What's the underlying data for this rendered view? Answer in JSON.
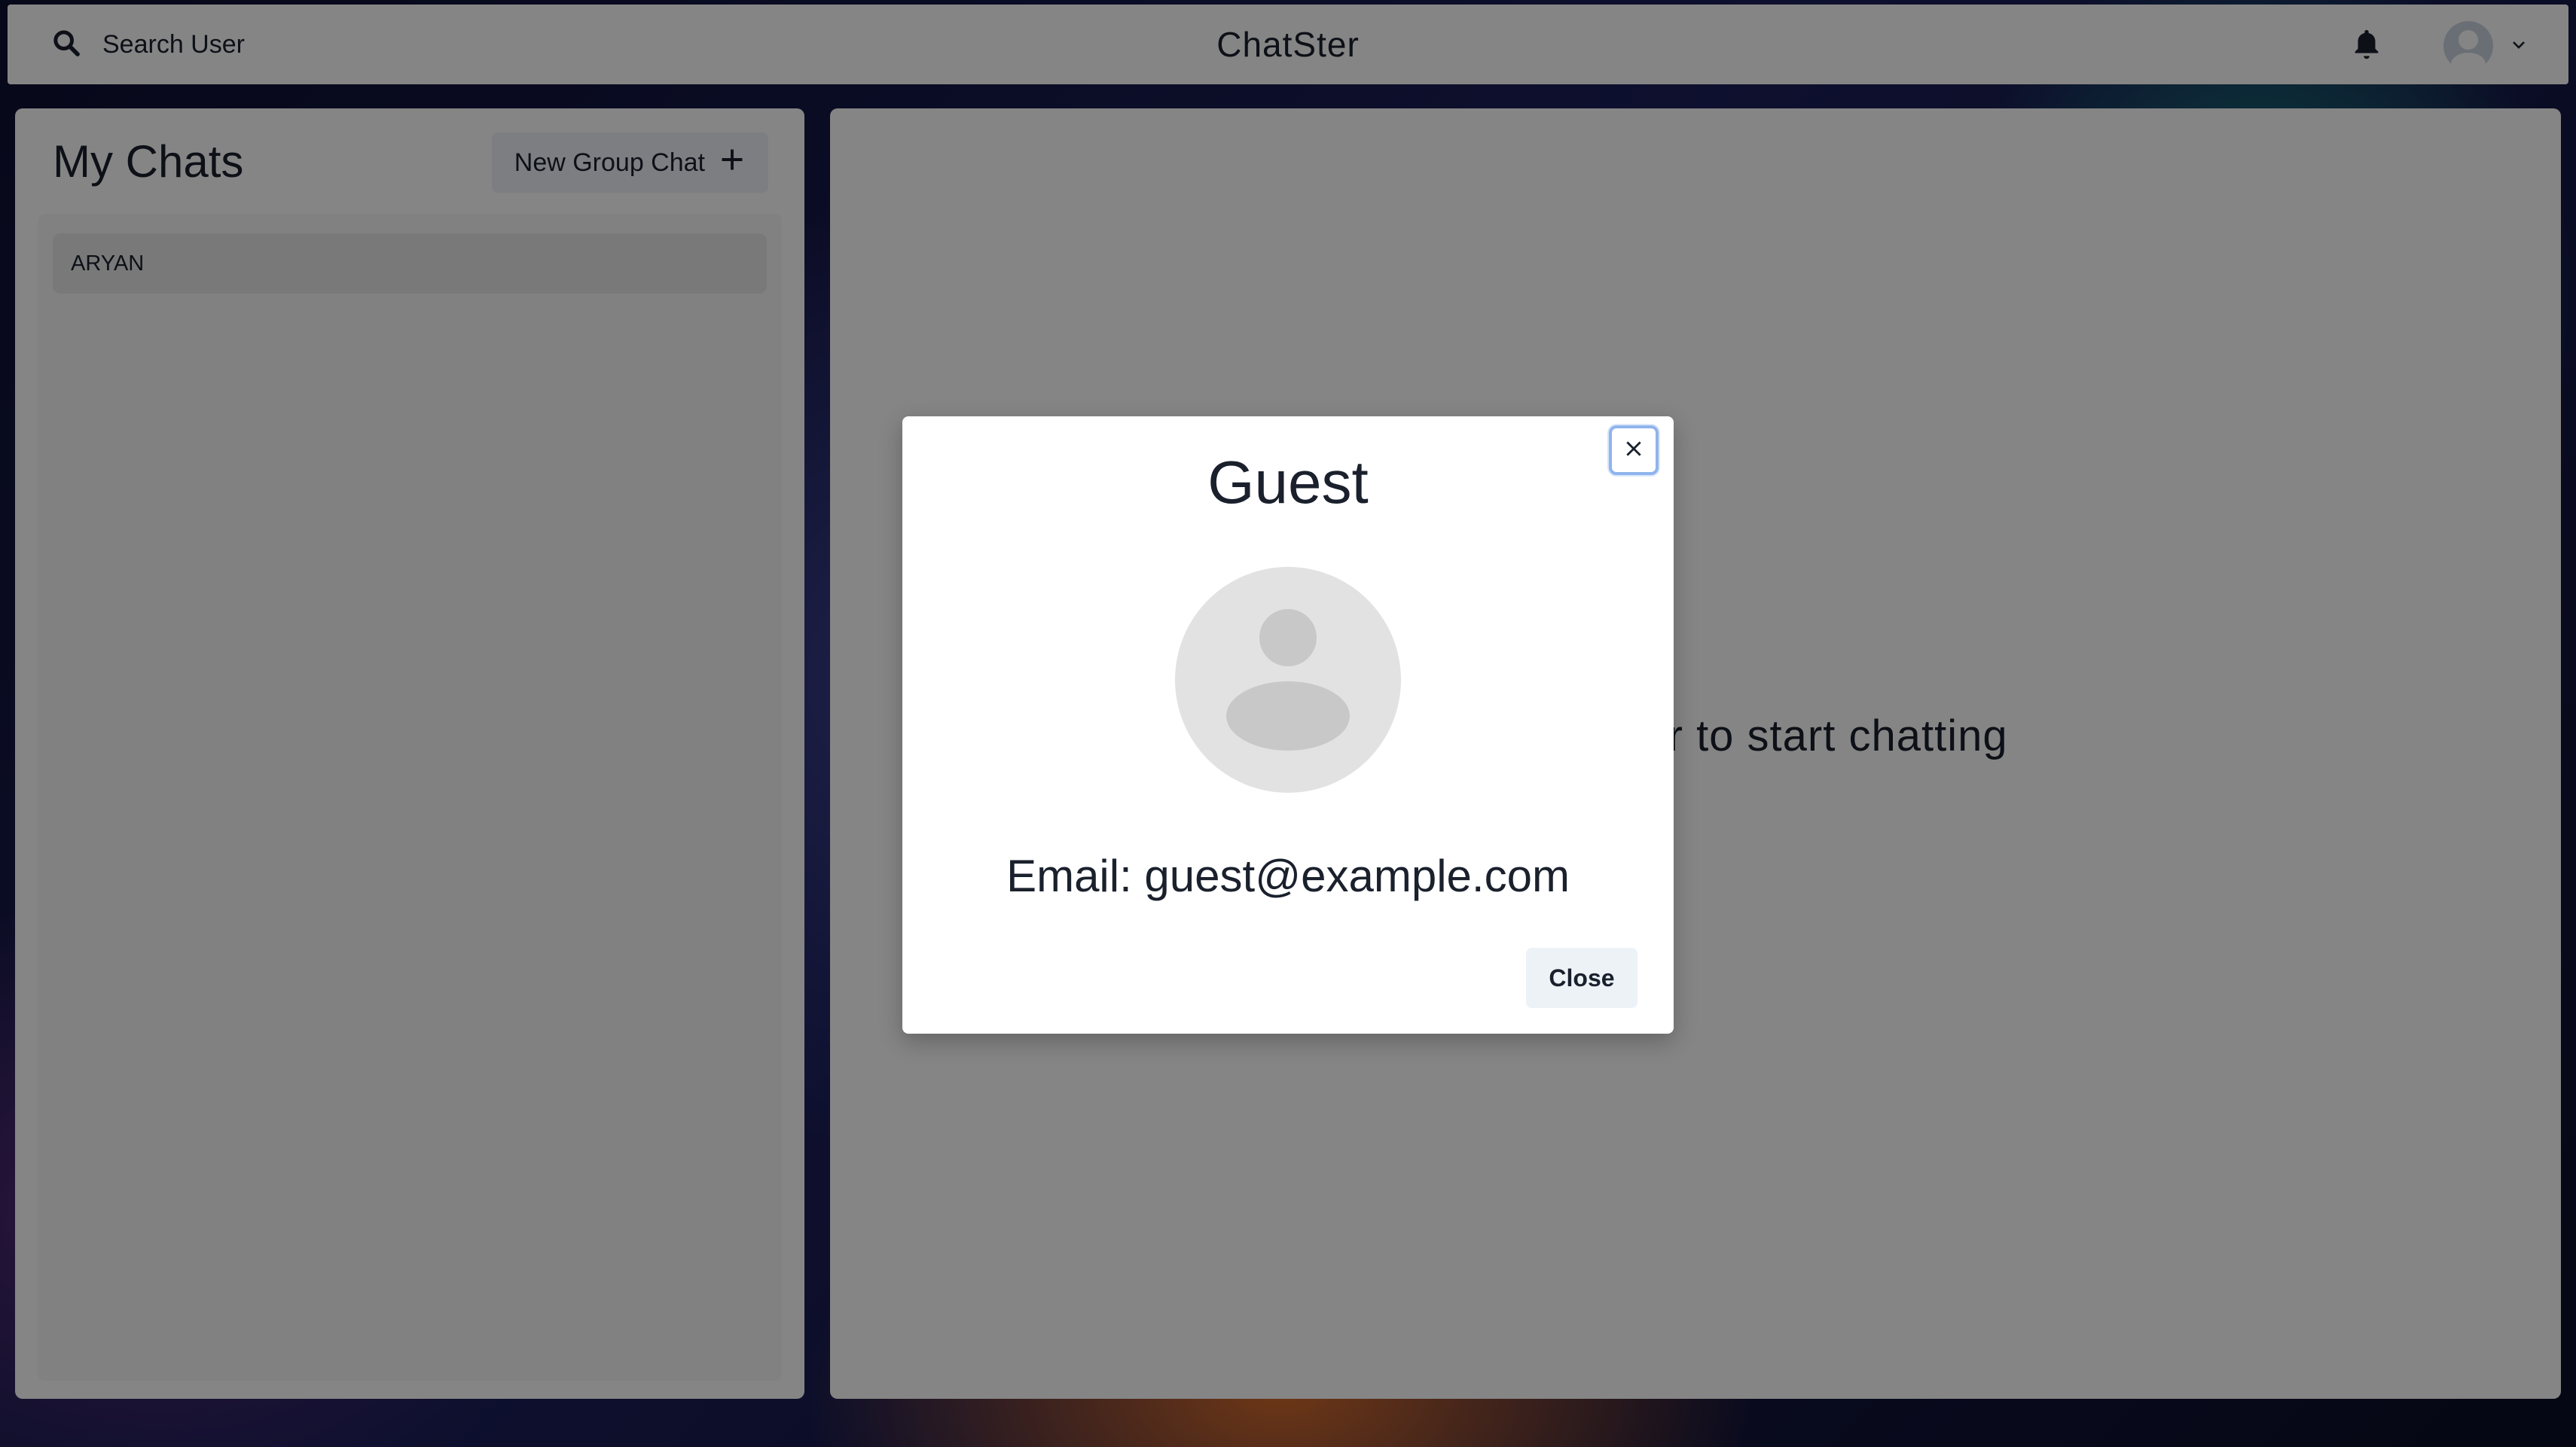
{
  "header": {
    "search_label": "Search User",
    "app_title": "ChatSter",
    "icons": {
      "search": "search-icon",
      "bell": "bell-icon",
      "avatar": "avatar",
      "chevron": "chevron-down-icon"
    }
  },
  "sidebar": {
    "title": "My Chats",
    "new_group_label": "New Group Chat",
    "chats": [
      {
        "name": "ARYAN"
      }
    ]
  },
  "main": {
    "empty_message": "Click on a user to start chatting"
  },
  "modal": {
    "title": "Guest",
    "email_text": "Email: guest@example.com",
    "close_label": "Close"
  },
  "colors": {
    "overlay": "rgba(0,0,0,0.48)",
    "focus_ring": "#90b4ec",
    "button_bg": "#edf2f7"
  }
}
